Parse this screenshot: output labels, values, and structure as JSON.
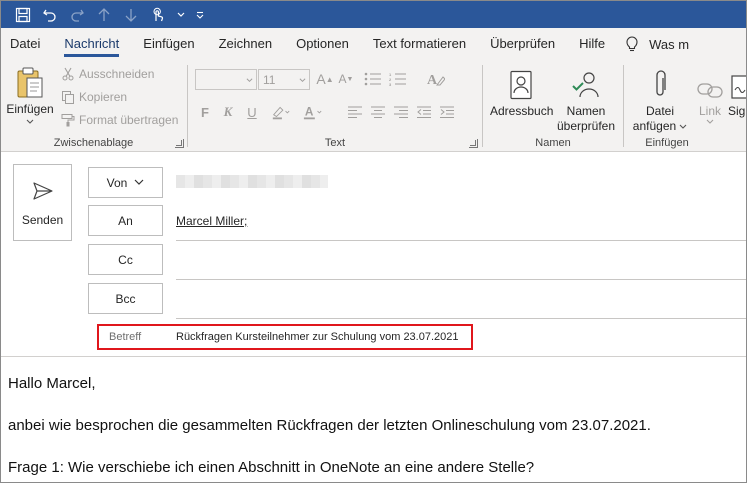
{
  "tabs": [
    {
      "label": "Datei"
    },
    {
      "label": "Nachricht"
    },
    {
      "label": "Einfügen"
    },
    {
      "label": "Zeichnen"
    },
    {
      "label": "Optionen"
    },
    {
      "label": "Text formatieren"
    },
    {
      "label": "Überprüfen"
    },
    {
      "label": "Hilfe"
    }
  ],
  "tell_me": "Was m",
  "ribbon": {
    "clipboard": {
      "label": "Zwischenablage",
      "paste": "Einfügen",
      "cut": "Ausschneiden",
      "copy": "Kopieren",
      "format_painter": "Format übertragen"
    },
    "text": {
      "label": "Text",
      "font_size": "11",
      "bold": "F",
      "italic": "K",
      "underline": "U"
    },
    "names": {
      "label": "Namen",
      "address_book": "Adressbuch",
      "check_names_1": "Namen",
      "check_names_2": "überprüfen"
    },
    "include": {
      "label": "Einfügen",
      "attach_1": "Datei",
      "attach_2": "anfügen",
      "link": "Link",
      "signature": "Sig"
    }
  },
  "compose": {
    "send": "Senden",
    "from_button": "Von",
    "to_button": "An",
    "cc_button": "Cc",
    "bcc_button": "Bcc",
    "to_value": "Marcel Miller;",
    "subject_label": "Betreff",
    "subject_value": "Rückfragen Kursteilnehmer zur Schulung vom 23.07.2021"
  },
  "body": {
    "greeting": "Hallo Marcel,",
    "line1": "anbei wie besprochen die gesammelten Rückfragen der letzten Onlineschulung vom 23.07.2021.",
    "line2": "Frage 1: Wie verschiebe ich einen Abschnitt in OneNote an eine andere Stelle?"
  },
  "colors": {
    "titlebar": "#2b579a",
    "highlight_box": "#e0161c"
  }
}
